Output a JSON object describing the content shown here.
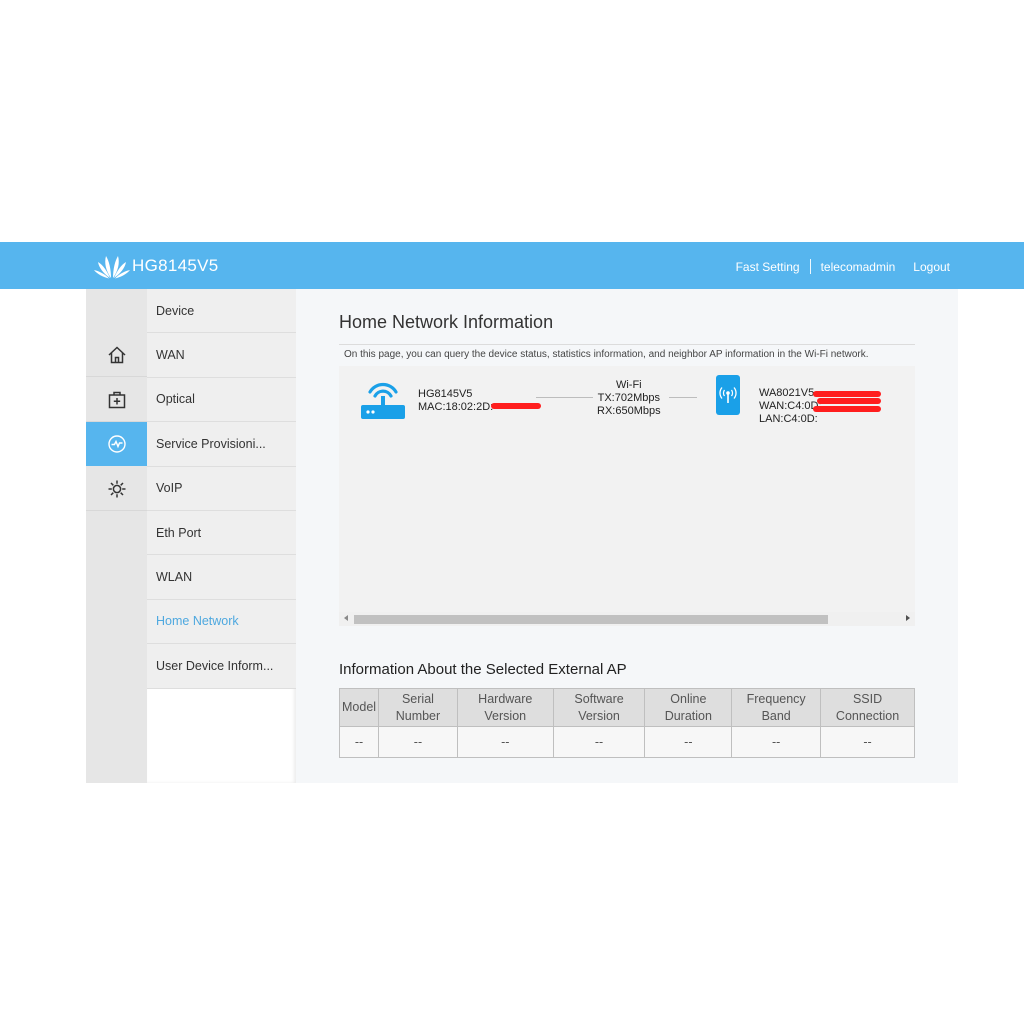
{
  "header": {
    "brand": "HG8145V5",
    "nav": {
      "fast_setting": "Fast Setting",
      "user": "telecomadmin",
      "logout": "Logout"
    },
    "colors": {
      "bar": "#56b5ee"
    }
  },
  "rail": {
    "items": [
      {
        "icon": "home-icon"
      },
      {
        "icon": "plus-box-icon"
      },
      {
        "icon": "pulse-icon",
        "active": true
      },
      {
        "icon": "gear-icon"
      }
    ]
  },
  "submenu": {
    "items": [
      {
        "label": "Device"
      },
      {
        "label": "WAN"
      },
      {
        "label": "Optical"
      },
      {
        "label": "Service Provisioni..."
      },
      {
        "label": "VoIP"
      },
      {
        "label": "Eth Port"
      },
      {
        "label": "WLAN"
      },
      {
        "label": "Home Network",
        "current": true
      },
      {
        "label": "User Device Inform..."
      }
    ]
  },
  "main": {
    "title": "Home Network Information",
    "description": "On this page, you can query the device status, statistics information, and neighbor AP information in the Wi-Fi network.",
    "topology": {
      "gateway": {
        "name": "HG8145V5",
        "mac": "MAC:18:02:2D:"
      },
      "link": {
        "type": "Wi-Fi",
        "tx": "TX:702Mbps",
        "rx": "RX:650Mbps"
      },
      "ap": {
        "name": "WA8021V5",
        "wan": "WAN:C4:0D:",
        "lan": "LAN:C4:0D:"
      }
    },
    "external_ap": {
      "title": "Information About the Selected External AP",
      "columns": [
        [
          "Model"
        ],
        [
          "Serial",
          "Number"
        ],
        [
          "Hardware",
          "Version"
        ],
        [
          "Software",
          "Version"
        ],
        [
          "Online",
          "Duration"
        ],
        [
          "Frequency",
          "Band"
        ],
        [
          "SSID",
          "Connection"
        ]
      ],
      "row": [
        "--",
        "--",
        "--",
        "--",
        "--",
        "--",
        "--"
      ]
    }
  }
}
